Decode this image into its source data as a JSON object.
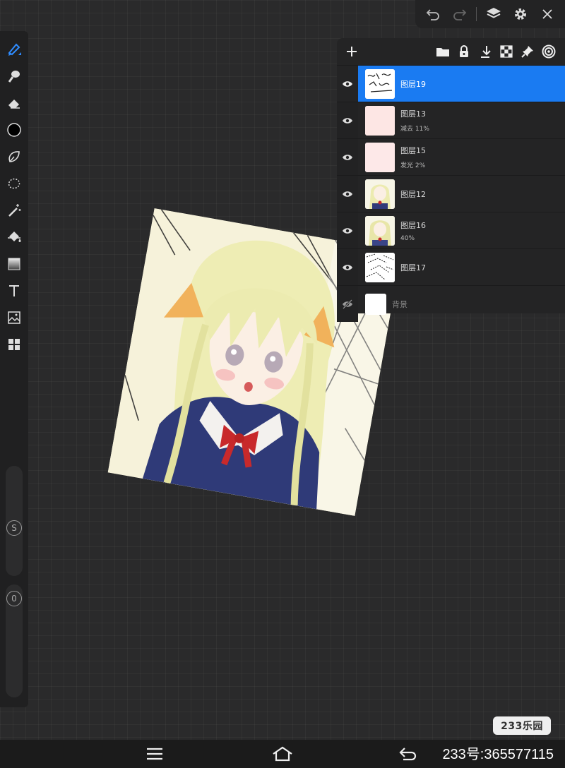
{
  "top_bar": {
    "icons": [
      "undo-icon",
      "redo-icon",
      "layers-icon",
      "settings-icon",
      "close-icon"
    ]
  },
  "left_toolbar": {
    "tools": [
      "brush-icon",
      "smudge-icon",
      "eraser-icon",
      "color-icon",
      "lasso-icon",
      "selection-icon",
      "magic-wand-icon",
      "fill-icon",
      "gradient-icon",
      "text-icon",
      "image-icon",
      "grid-icon"
    ],
    "size_label": "S",
    "opacity_label": "0"
  },
  "colors": {
    "accent": "#1a7bf2",
    "current_color": "#000000",
    "background": "#2a2a2b",
    "panel": "#242425"
  },
  "layers_panel": {
    "header_icons": [
      "add-layer-icon",
      "folder-icon",
      "lock-icon",
      "merge-down-icon",
      "transparency-icon",
      "pin-icon",
      "target-icon"
    ],
    "layers": [
      {
        "name": "图层19",
        "mode": "",
        "visible": true,
        "selected": true
      },
      {
        "name": "图层13",
        "mode": "减去   11%",
        "visible": true,
        "selected": false
      },
      {
        "name": "图层15",
        "mode": "发光   2%",
        "visible": true,
        "selected": false
      },
      {
        "name": "图层12",
        "mode": "",
        "visible": true,
        "selected": false
      },
      {
        "name": "图层16",
        "mode": "40%",
        "visible": true,
        "selected": false
      },
      {
        "name": "图层17",
        "mode": "",
        "visible": true,
        "selected": false
      },
      {
        "name": "背景",
        "mode": "",
        "visible": false,
        "selected": false
      }
    ]
  },
  "watermark": "233乐园",
  "nav_bar": {
    "id_text": "233号:365577115"
  }
}
